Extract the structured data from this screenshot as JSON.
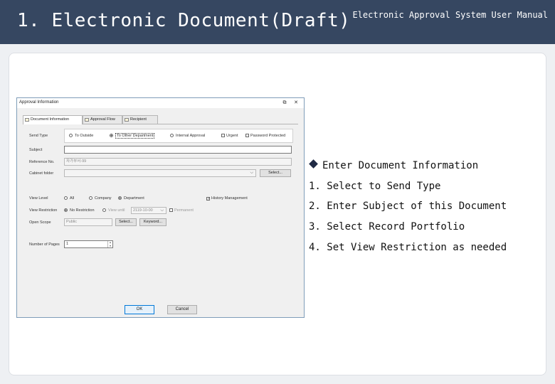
{
  "header": {
    "slide_title": "1. Electronic Document(Draft)",
    "manual_title": "Electronic Approval System User Manual"
  },
  "dialog": {
    "title": "Approval Information",
    "window_controls": {
      "restore_icon": "restore-icon",
      "close_icon": "close-icon"
    },
    "tabs": [
      {
        "label": "Document Information",
        "active": true
      },
      {
        "label": "Approval Flow",
        "active": false
      },
      {
        "label": "Recipient",
        "active": false
      }
    ],
    "form": {
      "send_type": {
        "label": "Send Type",
        "options": [
          "To Outside",
          "To Other Department",
          "Internal Approval"
        ],
        "selected": "To Other Department",
        "checkboxes": [
          "Urgent",
          "Password Protected"
        ]
      },
      "subject": {
        "label": "Subject",
        "value": ""
      },
      "reference_no": {
        "label": "Reference No.",
        "value": "자가부서-99"
      },
      "cabinet_folder": {
        "label": "Cabinet folder",
        "value": "",
        "select_button": "Select..."
      },
      "view_level": {
        "label": "View Level",
        "options": [
          "All",
          "Company",
          "Department"
        ],
        "selected": "Department",
        "history_checkbox": "History Management"
      },
      "view_restriction": {
        "label": "View Restriction",
        "options": [
          "No Restriction",
          "View until"
        ],
        "selected": "No Restriction",
        "date_value": "2119-10-00",
        "permanent_checkbox": "Permanent"
      },
      "open_scope": {
        "label": "Open Scope",
        "value": "Public",
        "select_button": "Select...",
        "keyword_button": "Keyword..."
      },
      "number_of_pages": {
        "label": "Number of Pages",
        "value": "1"
      }
    },
    "ok_label": "OK",
    "cancel_label": "Cancel"
  },
  "instructions": {
    "heading": "Enter Document Information",
    "steps": [
      "1. Select to Send Type",
      "2. Enter Subject of this Document",
      "3. Select Record Portfolio",
      "4. Set View Restriction as  needed"
    ]
  },
  "colors": {
    "header_bg": "#364761",
    "slide_bg": "#eef0f3",
    "dialog_border": "#7f9db9",
    "ok_button_border": "#0078d7"
  }
}
